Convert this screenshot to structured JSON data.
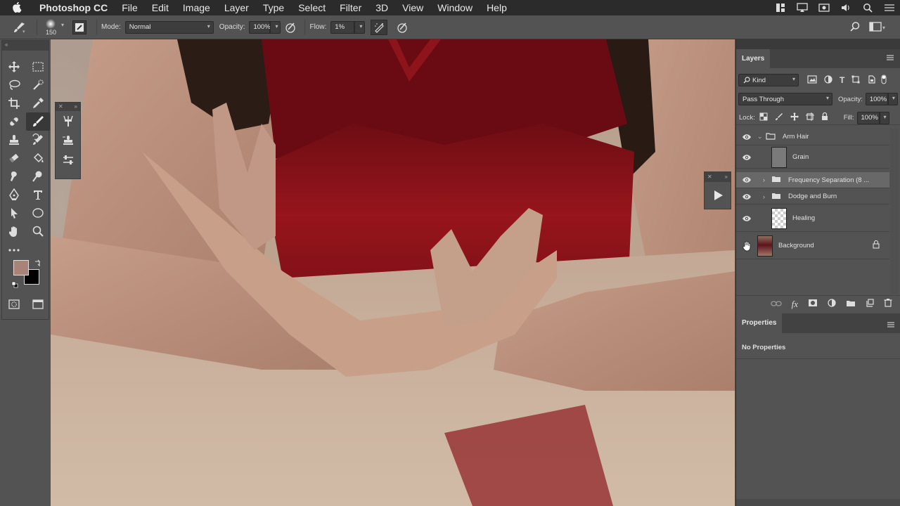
{
  "menubar": {
    "app_name": "Photoshop CC",
    "items": [
      "File",
      "Edit",
      "Image",
      "Layer",
      "Type",
      "Select",
      "Filter",
      "3D",
      "View",
      "Window",
      "Help"
    ]
  },
  "options_bar": {
    "brush_size": "150",
    "mode_label": "Mode:",
    "mode_value": "Normal",
    "opacity_label": "Opacity:",
    "opacity_value": "100%",
    "flow_label": "Flow:",
    "flow_value": "1%"
  },
  "layers_panel": {
    "tab_label": "Layers",
    "filter_value": "Kind",
    "blend_mode": "Pass Through",
    "opacity_label": "Opacity:",
    "opacity_value": "100%",
    "lock_label": "Lock:",
    "fill_label": "Fill:",
    "fill_value": "100%",
    "layers": [
      {
        "name": "Arm Hair"
      },
      {
        "name": "Grain"
      },
      {
        "name": "Frequency Separation (8 ..."
      },
      {
        "name": "Dodge and Burn"
      },
      {
        "name": "Healing"
      },
      {
        "name": "Background"
      }
    ]
  },
  "properties_panel": {
    "tab_label": "Properties",
    "content": "No Properties"
  },
  "colors": {
    "foreground": "#a88378",
    "background": "#000000",
    "selected_layer": "#686868"
  }
}
